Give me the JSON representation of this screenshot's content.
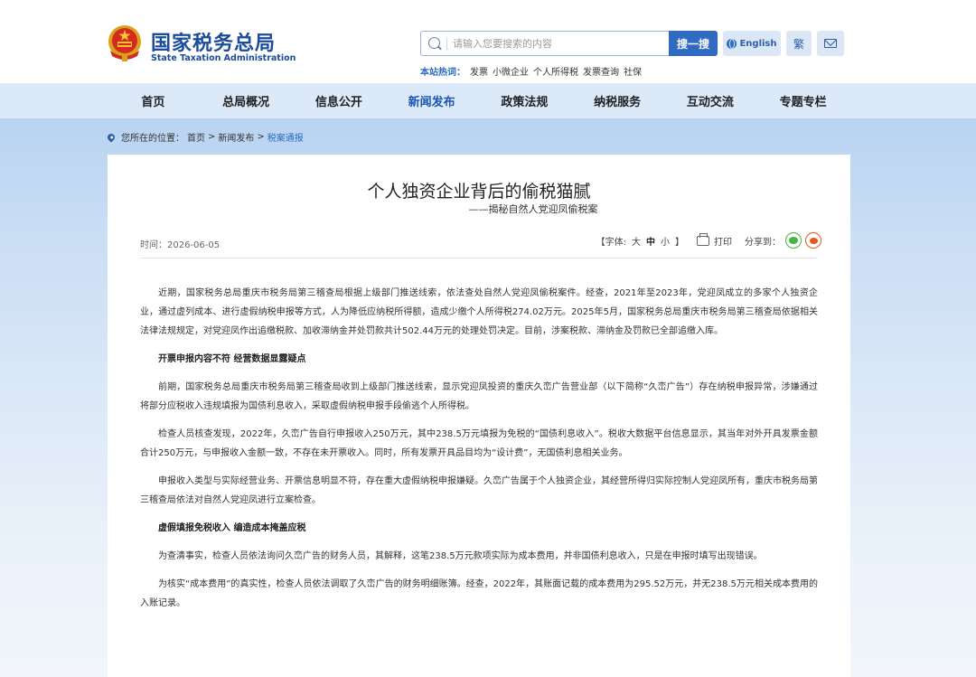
{
  "header": {
    "logo_cn": "国家税务总局",
    "logo_en": "State Taxation Administration",
    "search_placeholder": "请输入您要搜索的内容",
    "search_button": "搜一搜",
    "english_button": "English",
    "traditional_button": "繁",
    "hot_label": "本站热词：",
    "hot_words": [
      "发票",
      "小微企业",
      "个人所得税",
      "发票查询",
      "社保"
    ]
  },
  "nav": {
    "items": [
      "首页",
      "总局概况",
      "信息公开",
      "新闻发布",
      "政策法规",
      "纳税服务",
      "互动交流",
      "专题专栏"
    ],
    "active_index": 3
  },
  "breadcrumb": {
    "prefix": "您所在的位置：",
    "items": [
      "首页",
      "新闻发布",
      "税案通报"
    ],
    "separator": ">"
  },
  "article": {
    "title": "个人独资企业背后的偷税猫腻",
    "subtitle": "——揭秘自然人党迎凤偷税案",
    "date": "时间：2026-06-05",
    "font_size_label": "【字体:",
    "font_sizes": [
      "大",
      "中",
      "小"
    ],
    "font_size_end": "】",
    "print_label": "打印",
    "share_label": "分享到：",
    "paragraphs": [
      {
        "type": "p",
        "text": "近期，国家税务总局重庆市税务局第三稽查局根据上级部门推送线索，依法查处自然人党迎凤偷税案件。经查，2021年至2023年，党迎凤成立的多家个人独资企业，通过虚列成本、进行虚假纳税申报等方式，人为降低应纳税所得额，造成少缴个人所得税274.02万元。2025年5月，国家税务总局重庆市税务局第三稽查局依据相关法律法规规定，对党迎凤作出追缴税款、加收滞纳金并处罚款共计502.44万元的处理处罚决定。目前，涉案税款、滞纳金及罚款已全部追缴入库。"
      },
      {
        "type": "h",
        "text": "开票申报内容不符 经营数据显露疑点"
      },
      {
        "type": "p",
        "text": "前期，国家税务总局重庆市税务局第三稽查局收到上级部门推送线索，显示党迎凤投资的重庆久峦广告营业部（以下简称“久峦广告”）存在纳税申报异常，涉嫌通过将部分应税收入违规填报为国债利息收入，采取虚假纳税申报手段偷逃个人所得税。"
      },
      {
        "type": "p",
        "text": "检查人员核查发现，2022年，久峦广告自行申报收入250万元，其中238.5万元填报为免税的“国债利息收入”。税收大数据平台信息显示，其当年对外开具发票金额合计250万元，与申报收入金额一致，不存在未开票收入。同时，所有发票开具品目均为“设计费”，无国债利息相关业务。"
      },
      {
        "type": "p",
        "text": "申报收入类型与实际经营业务、开票信息明显不符，存在重大虚假纳税申报嫌疑。久峦广告属于个人独资企业，其经营所得归实际控制人党迎凤所有，重庆市税务局第三稽查局依法对自然人党迎凤进行立案检查。"
      },
      {
        "type": "h",
        "text": "虚假填报免税收入 编造成本掩盖应税"
      },
      {
        "type": "p",
        "text": "为查清事实，检查人员依法询问久峦广告的财务人员，其解释，这笔238.5万元款项实际为成本费用，并非国债利息收入，只是在申报时填写出现错误。"
      },
      {
        "type": "p",
        "text": "为核实“成本费用”的真实性，检查人员依法调取了久峦广告的财务明细账簿。经查，2022年，其账面记载的成本费用为295.52万元，并无238.5万元相关成本费用的入账记录。"
      }
    ]
  }
}
